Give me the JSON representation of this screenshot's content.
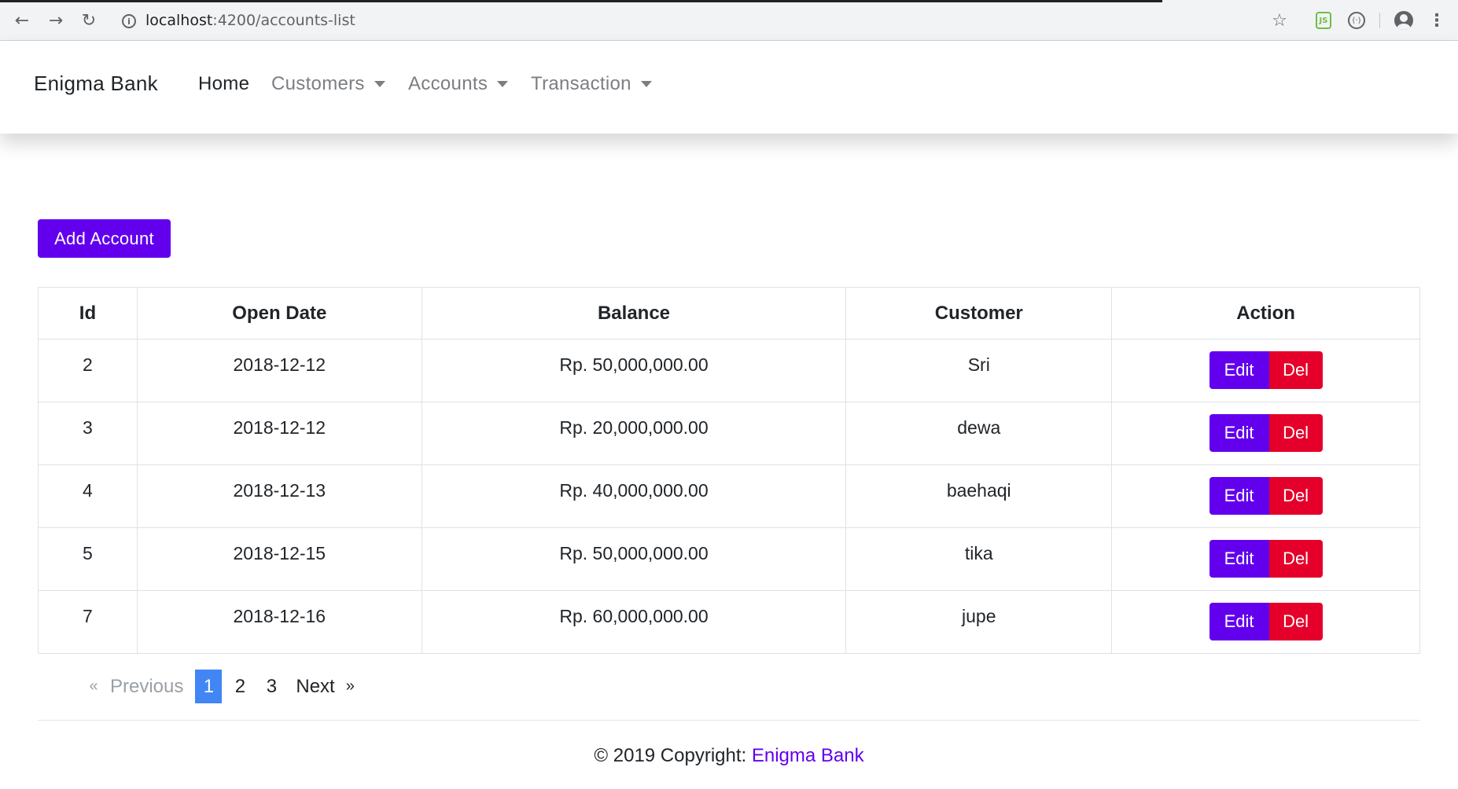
{
  "browser": {
    "back_glyph": "←",
    "forward_glyph": "→",
    "reload_glyph": "↻",
    "info_glyph": "i",
    "url_host": "localhost",
    "url_path": ":4200/accounts-list",
    "star_glyph": "☆",
    "ext_node_label": "JS",
    "ext_ring_label": "(·)",
    "menu_glyph": "⋮"
  },
  "navbar": {
    "brand": "Enigma Bank",
    "items": [
      {
        "label": "Home",
        "active": true,
        "dropdown": false
      },
      {
        "label": "Customers",
        "active": false,
        "dropdown": true
      },
      {
        "label": "Accounts",
        "active": false,
        "dropdown": true
      },
      {
        "label": "Transaction",
        "active": false,
        "dropdown": true
      }
    ]
  },
  "main": {
    "add_button_label": "Add Account",
    "table": {
      "headers": [
        "Id",
        "Open Date",
        "Balance",
        "Customer",
        "Action"
      ],
      "rows": [
        {
          "id": "2",
          "open_date": "2018-12-12",
          "balance": "Rp. 50,000,000.00",
          "customer": "Sri"
        },
        {
          "id": "3",
          "open_date": "2018-12-12",
          "balance": "Rp. 20,000,000.00",
          "customer": "dewa"
        },
        {
          "id": "4",
          "open_date": "2018-12-13",
          "balance": "Rp. 40,000,000.00",
          "customer": "baehaqi"
        },
        {
          "id": "5",
          "open_date": "2018-12-15",
          "balance": "Rp. 50,000,000.00",
          "customer": "tika"
        },
        {
          "id": "7",
          "open_date": "2018-12-16",
          "balance": "Rp. 60,000,000.00",
          "customer": "jupe"
        }
      ],
      "edit_label": "Edit",
      "del_label": "Del"
    },
    "pagination": {
      "first_glyph": "«",
      "previous_label": "Previous",
      "pages": [
        "1",
        "2",
        "3"
      ],
      "current_page": "1",
      "next_label": "Next",
      "last_glyph": "»"
    }
  },
  "footer": {
    "copyright_text": "© 2019 Copyright: ",
    "link_text": "Enigma Bank"
  },
  "colors": {
    "primary": "#6200ee",
    "danger": "#e4002b",
    "pagination_active": "#4285f4"
  }
}
